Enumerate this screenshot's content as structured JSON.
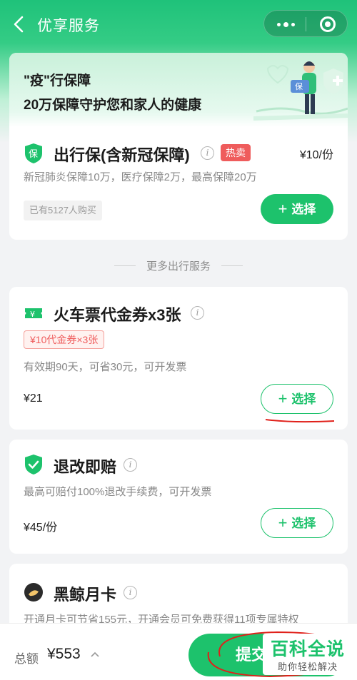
{
  "nav": {
    "title": "优享服务"
  },
  "banner": {
    "line1": "\"疫\"行保障",
    "line2": "20万保障守护您和家人的健康",
    "illustration_badge": "保"
  },
  "insurance": {
    "icon_char": "保",
    "title": "出行保(含新冠保障)",
    "hot_badge": "热卖",
    "price": "¥10/份",
    "desc": "新冠肺炎保障10万，医疗保障2万，最高保障20万",
    "sold": "已有5127人购买",
    "select_label": "选择"
  },
  "divider": {
    "label": "更多出行服务"
  },
  "services": [
    {
      "title": "火车票代金券x3张",
      "tag": "¥10代金券×3张",
      "desc": "有效期90天，可省30元，可开发票",
      "price": "¥21",
      "select_label": "选择"
    },
    {
      "title": "退改即赔",
      "desc": "最高可赔付100%退改手续费，可开发票",
      "price": "¥45/份",
      "select_label": "选择"
    },
    {
      "title": "黑鲸月卡",
      "desc": "开通月卡可节省155元，开通会员可免费获得11项专属特权"
    }
  ],
  "footer": {
    "total_label": "总额",
    "total_value": "¥553",
    "submit_label": "提交"
  },
  "watermark": {
    "main": "百科全说",
    "sub": "助你轻松解决"
  },
  "colors": {
    "brand_green": "#1dc26c",
    "hot_red": "#ef5c5c",
    "annotation_red": "#e0201a"
  }
}
